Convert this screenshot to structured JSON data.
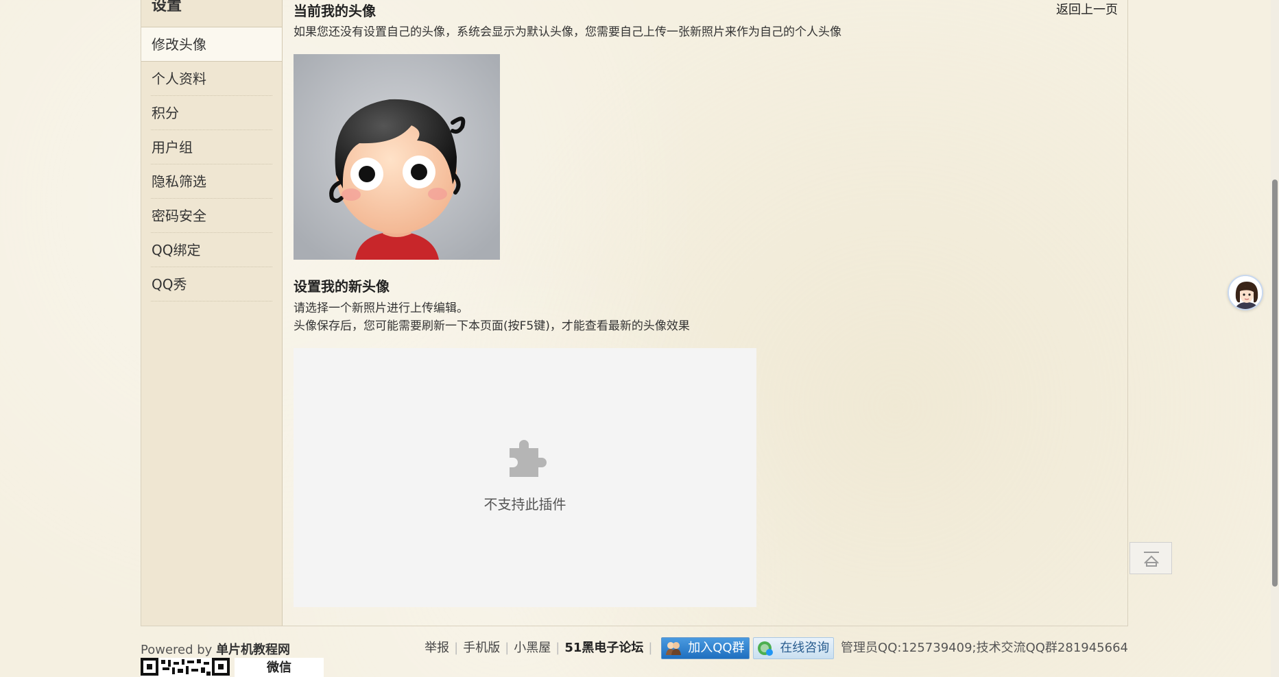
{
  "sidebar": {
    "title": "设置",
    "items": [
      {
        "label": "修改头像",
        "active": true
      },
      {
        "label": "个人资料"
      },
      {
        "label": "积分"
      },
      {
        "label": "用户组"
      },
      {
        "label": "隐私筛选"
      },
      {
        "label": "密码安全"
      },
      {
        "label": "QQ绑定"
      },
      {
        "label": "QQ秀"
      }
    ]
  },
  "main": {
    "current_title": "当前我的头像",
    "current_desc": "如果您还没有设置自己的头像，系统会显示为默认头像，您需要自己上传一张新照片来作为自己的个人头像",
    "back_link": "返回上一页",
    "new_title": "设置我的新头像",
    "new_desc_1": "请选择一个新照片进行上传编辑。",
    "new_desc_2": "头像保存后，您可能需要刷新一下本页面(按F5键)，才能查看最新的头像效果",
    "plugin_unsupported": "不支持此插件"
  },
  "footer": {
    "powered_prefix": "Powered by",
    "powered_site": "单片机教程网",
    "links": [
      "举报",
      "手机版",
      "小黑屋"
    ],
    "forum": "51黑电子论坛",
    "join_qq": "加入QQ群",
    "consult": "在线咨询",
    "admin_info": "管理员QQ:125739409;技术交流QQ群281945664",
    "wechat": "微信"
  },
  "colors": {
    "page_bg": "#f5f0e1",
    "sidebar_bg": "#efe6d2",
    "plugin_bg": "#f4f4f4"
  }
}
